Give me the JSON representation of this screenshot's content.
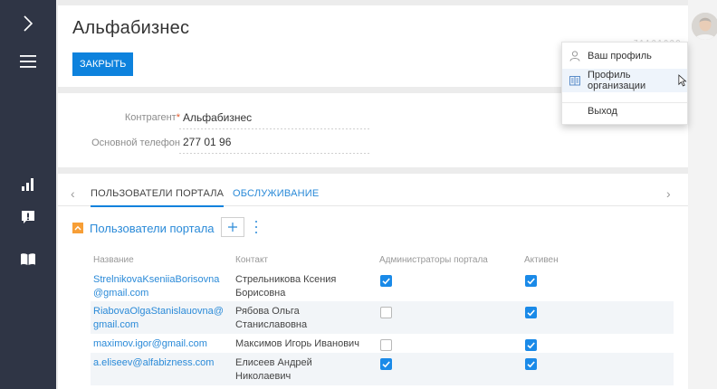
{
  "sidebar": {
    "icons": [
      "chevron-right-icon",
      "hamburger-menu-icon",
      "bar-chart-icon",
      "alert-icon",
      "book-icon"
    ]
  },
  "header": {
    "title": "Альфабизнес",
    "close_label": "ЗАКРЫТЬ"
  },
  "fields": {
    "contractor": {
      "label": "Контрагент",
      "required_mark": "*",
      "value": "Альфабизнес"
    },
    "phone": {
      "label": "Основной телефон",
      "value": "277 01 96"
    }
  },
  "tabs": {
    "items": [
      "ПОЛЬЗОВАТЕЛИ ПОРТАЛА",
      "ОБСЛУЖИВАНИЕ"
    ],
    "active_index": 0
  },
  "detail": {
    "title": "Пользователи портала",
    "add_symbol": "+",
    "columns": [
      "Название",
      "Контакт",
      "Администраторы портала",
      "Активен"
    ],
    "rows": [
      {
        "name_1": "StrelnikovaKseniiaBorisovna",
        "name_2": "@gmail.com",
        "contact_1": "Стрельникова Ксения",
        "contact_2": "Борисовна",
        "admin": true,
        "active": true
      },
      {
        "name_1": "RiabovaOlgaStanislauovna@",
        "name_2": "gmail.com",
        "contact_1": "Рябова Ольга",
        "contact_2": "Станиславовна",
        "admin": false,
        "active": true
      },
      {
        "name_1": "maximov.igor@gmail.com",
        "name_2": "",
        "contact_1": "Максимов Игорь Иванович",
        "contact_2": "",
        "admin": false,
        "active": true
      },
      {
        "name_1": "a.eliseev@alfabizness.com",
        "name_2": "",
        "contact_1": "Елисеев Андрей",
        "contact_2": "Николаевич",
        "admin": true,
        "active": true
      }
    ]
  },
  "profile_menu": {
    "items": [
      "Ваш профиль",
      "Профиль организации",
      "Выход"
    ],
    "hovered_index": 1
  },
  "colors": {
    "sidebar": "#2f3545",
    "accent": "#0d82dd",
    "link": "#2a8ad8",
    "collapse": "#f79e36",
    "checkbox_on": "#1a8ae8"
  }
}
